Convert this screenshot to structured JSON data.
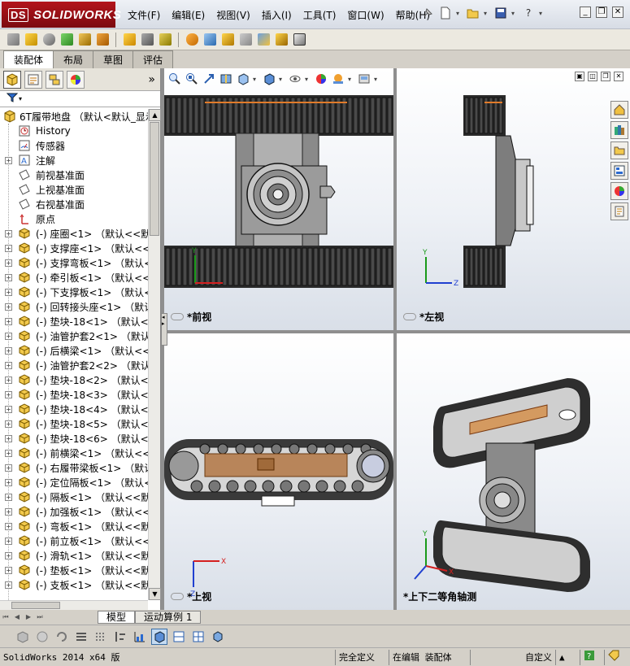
{
  "app": {
    "logo_text": "SOLIDWORKS",
    "logo_prefix": "DS"
  },
  "menu": [
    "文件(F)",
    "编辑(E)",
    "视图(V)",
    "插入(I)",
    "工具(T)",
    "窗口(W)",
    "帮助(H)"
  ],
  "command_tabs": [
    {
      "label": "装配体",
      "active": true
    },
    {
      "label": "布局",
      "active": false
    },
    {
      "label": "草图",
      "active": false
    },
    {
      "label": "评估",
      "active": false
    }
  ],
  "feature_tree": {
    "root": "6T履带地盘 （默认<默认_显示",
    "items": [
      {
        "text": "History",
        "icon": "history-icon",
        "expander": ""
      },
      {
        "text": "传感器",
        "icon": "sensor-icon",
        "expander": ""
      },
      {
        "text": "注解",
        "icon": "annotation-icon",
        "expander": "+"
      },
      {
        "text": "前视基准面",
        "icon": "plane-icon",
        "expander": ""
      },
      {
        "text": "上视基准面",
        "icon": "plane-icon",
        "expander": ""
      },
      {
        "text": "右视基准面",
        "icon": "plane-icon",
        "expander": ""
      },
      {
        "text": "原点",
        "icon": "origin-icon",
        "expander": ""
      },
      {
        "text": "(-) 座圈<1> （默认<<默认",
        "icon": "part-icon",
        "expander": "+"
      },
      {
        "text": "(-) 支撑座<1> （默认<<默",
        "icon": "part-icon",
        "expander": "+"
      },
      {
        "text": "(-) 支撑弯板<1> （默认<<",
        "icon": "part-icon",
        "expander": "+"
      },
      {
        "text": "(-) 牵引板<1> （默认<<默认",
        "icon": "part-icon",
        "expander": "+"
      },
      {
        "text": "(-) 下支撑板<1> （默认<<",
        "icon": "part-icon",
        "expander": "+"
      },
      {
        "text": "(-) 回转接头座<1> （默认",
        "icon": "part-icon",
        "expander": "+"
      },
      {
        "text": "(-) 垫块-18<1> （默认<<默",
        "icon": "part-icon",
        "expander": "+"
      },
      {
        "text": "(-) 油管护套2<1> （默认<<",
        "icon": "part-icon",
        "expander": "+"
      },
      {
        "text": "(-) 后横梁<1> （默认<<默",
        "icon": "part-icon",
        "expander": "+"
      },
      {
        "text": "(-) 油管护套2<2> （默认<<",
        "icon": "part-icon",
        "expander": "+"
      },
      {
        "text": "(-) 垫块-18<2> （默认<<默",
        "icon": "part-icon",
        "expander": "+"
      },
      {
        "text": "(-) 垫块-18<3> （默认<<默",
        "icon": "part-icon",
        "expander": "+"
      },
      {
        "text": "(-) 垫块-18<4> （默认<<默",
        "icon": "part-icon",
        "expander": "+"
      },
      {
        "text": "(-) 垫块-18<5> （默认<<默",
        "icon": "part-icon",
        "expander": "+"
      },
      {
        "text": "(-) 垫块-18<6> （默认<<默",
        "icon": "part-icon",
        "expander": "+"
      },
      {
        "text": "(-) 前横梁<1> （默认<<默",
        "icon": "part-icon",
        "expander": "+"
      },
      {
        "text": "(-) 右履带梁板<1> （默认",
        "icon": "part-icon",
        "expander": "+"
      },
      {
        "text": "(-) 定位隔板<1> （默认<<",
        "icon": "part-icon",
        "expander": "+"
      },
      {
        "text": "(-) 隔板<1> （默认<<默认",
        "icon": "part-icon",
        "expander": "+"
      },
      {
        "text": "(-) 加强板<1> （默认<<默",
        "icon": "part-icon",
        "expander": "+"
      },
      {
        "text": "(-) 弯板<1> （默认<<默认",
        "icon": "part-icon",
        "expander": "+"
      },
      {
        "text": "(-) 前立板<1> （默认<<默",
        "icon": "part-icon",
        "expander": "+"
      },
      {
        "text": "(-) 滑轨<1> （默认<<默认",
        "icon": "part-icon",
        "expander": "+"
      },
      {
        "text": "(-) 垫板<1> （默认<<默认",
        "icon": "part-icon",
        "expander": "+"
      },
      {
        "text": "(-) 支板<1> （默认<<默认",
        "icon": "part-icon",
        "expander": "+"
      }
    ]
  },
  "viewports": {
    "front": "*前视",
    "left": "*左视",
    "top": "*上视",
    "iso": "*上下二等角轴测"
  },
  "model_tabs": [
    {
      "label": "模型",
      "active": true
    },
    {
      "label": "运动算例 1",
      "active": false
    }
  ],
  "status": {
    "version": "SolidWorks 2014 x64 版",
    "definition": "完全定义",
    "mode": "在编辑 装配体",
    "units": "自定义"
  },
  "colors": {
    "accent_red": "#b3141b",
    "track_dark": "#2b2b2b",
    "body_grey": "#8a8a8a",
    "highlight_orange": "#e07b2a",
    "axis_x": "#d42020",
    "axis_y": "#1a9a1a",
    "axis_z": "#2040d0"
  }
}
